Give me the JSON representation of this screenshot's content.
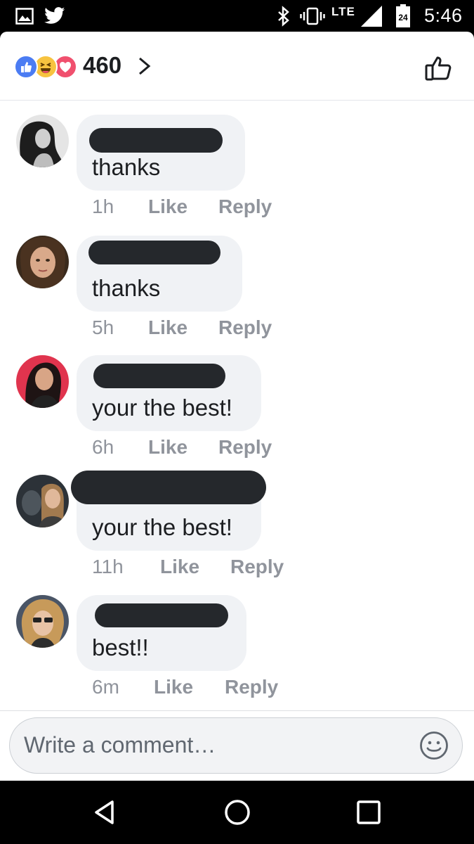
{
  "status_bar": {
    "network": "LTE",
    "battery_level": "24",
    "time": "5:46",
    "icons": [
      "gallery-icon",
      "twitter-icon",
      "bluetooth-icon",
      "vibrate-icon",
      "signal-icon",
      "battery-icon"
    ]
  },
  "header": {
    "reactions": [
      "like",
      "haha",
      "love"
    ],
    "reaction_count": "460"
  },
  "comments": [
    {
      "text": "thanks",
      "time": "1h",
      "like_label": "Like",
      "reply_label": "Reply"
    },
    {
      "text": "thanks",
      "time": "5h",
      "like_label": "Like",
      "reply_label": "Reply"
    },
    {
      "text": "your the best!",
      "time": "6h",
      "like_label": "Like",
      "reply_label": "Reply"
    },
    {
      "text": "your the best!",
      "time": "11h",
      "like_label": "Like",
      "reply_label": "Reply"
    },
    {
      "text": "best!!",
      "time": "6m",
      "like_label": "Like",
      "reply_label": "Reply"
    }
  ],
  "composer": {
    "placeholder": "Write a comment…",
    "value": ""
  },
  "colors": {
    "like_blue": "#4b7cf3",
    "haha_yellow": "#f7c33f",
    "love_red": "#f0506e",
    "bubble_bg": "#f0f2f5",
    "meta_gray": "#90949c",
    "redaction": "#25282c"
  }
}
